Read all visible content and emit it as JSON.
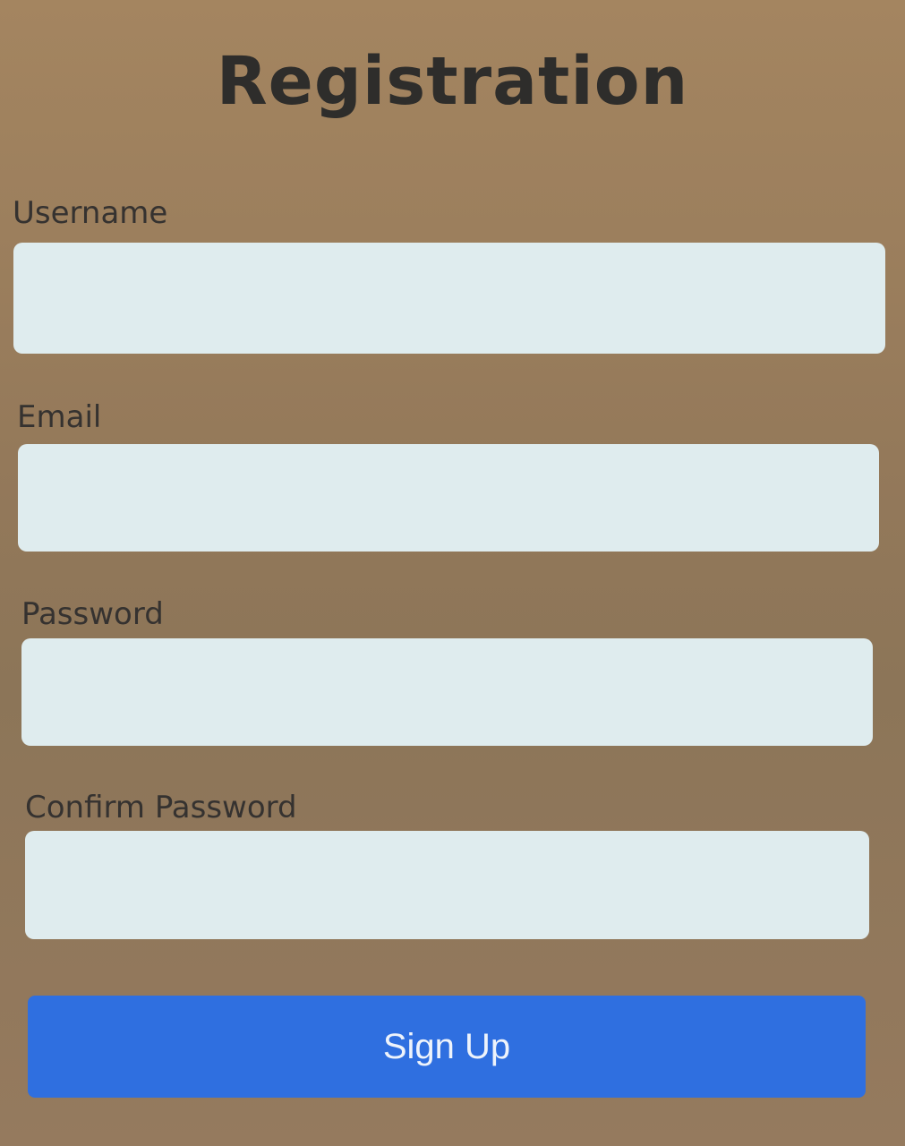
{
  "form": {
    "title": "Registration",
    "fields": [
      {
        "label": "Username",
        "value": "",
        "placeholder": ""
      },
      {
        "label": "Email",
        "value": "",
        "placeholder": ""
      },
      {
        "label": "Password",
        "value": "",
        "placeholder": ""
      },
      {
        "label": "Confirm Password",
        "value": "",
        "placeholder": ""
      }
    ],
    "submit_label": "Sign Up"
  },
  "colors": {
    "background": "#957a5e",
    "input_background": "#dfecee",
    "button": "#2f6fe0",
    "button_text": "#eef3fb",
    "title_text": "#2e2d2b",
    "label_text": "#353230"
  }
}
